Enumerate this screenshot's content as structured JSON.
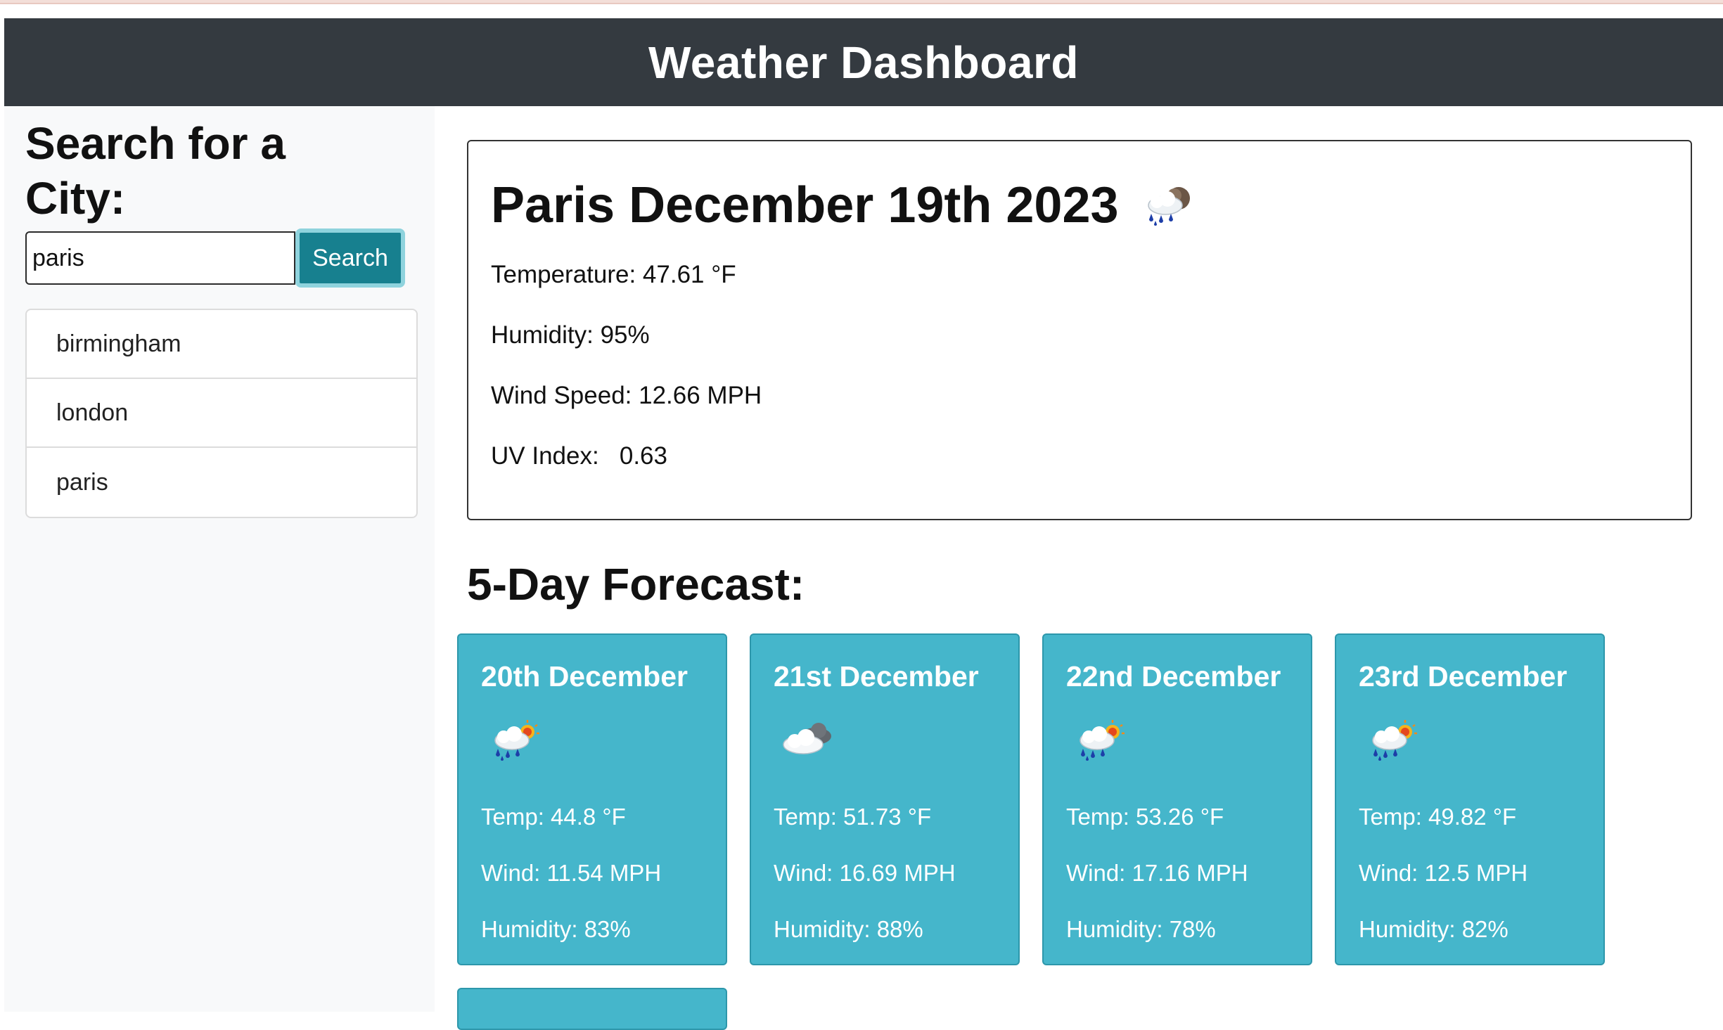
{
  "header": {
    "title": "Weather Dashboard"
  },
  "sidebar": {
    "title": "Search for a City:",
    "search_value": "paris",
    "search_button": "Search",
    "history": [
      "birmingham",
      "london",
      "paris"
    ]
  },
  "current": {
    "title": "Paris December 19th 2023",
    "icon": "rain-cloud-icon",
    "temperature": "Temperature: 47.61 °F",
    "humidity": "Humidity: 95%",
    "wind": "Wind Speed: 12.66 MPH",
    "uv": "UV Index:   0.63"
  },
  "forecast": {
    "title": "5-Day Forecast:",
    "days": [
      {
        "date": "20th December",
        "icon": "rain-sun-icon",
        "temp": "Temp: 44.8 °F",
        "wind": "Wind: 11.54 MPH",
        "humidity": "Humidity: 83%"
      },
      {
        "date": "21st December",
        "icon": "cloud-icon",
        "temp": "Temp: 51.73 °F",
        "wind": "Wind: 16.69 MPH",
        "humidity": "Humidity: 88%"
      },
      {
        "date": "22nd December",
        "icon": "rain-sun-icon",
        "temp": "Temp: 53.26 °F",
        "wind": "Wind: 17.16 MPH",
        "humidity": "Humidity: 78%"
      },
      {
        "date": "23rd December",
        "icon": "rain-sun-icon",
        "temp": "Temp: 49.82 °F",
        "wind": "Wind: 12.5 MPH",
        "humidity": "Humidity: 82%"
      }
    ]
  },
  "colors": {
    "header_bg": "#343a40",
    "card_bg": "#45b6cb",
    "button_bg": "#17808f"
  }
}
